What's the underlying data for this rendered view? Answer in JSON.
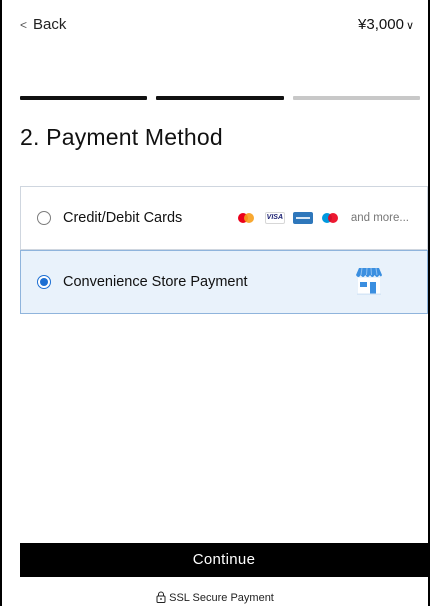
{
  "header": {
    "back_icon": "chevron-left-icon",
    "back_label": "Back",
    "price": "¥3,000",
    "price_icon": "chevron-down-icon"
  },
  "progress": {
    "steps_total": 3,
    "current_step": 2,
    "active_color": "#111111",
    "inactive_color": "#c8c8c8"
  },
  "page": {
    "title": "2. Payment Method"
  },
  "payment_methods": [
    {
      "label": "Credit/Debit Cards",
      "selected": false,
      "icons": [
        "mastercard-icon",
        "visa-icon",
        "amex-icon",
        "maestro-icon"
      ],
      "visa_text": "VISA",
      "more_text": "and more..."
    },
    {
      "label": "Convenience Store Payment",
      "selected": true,
      "icon": "storefront-icon"
    }
  ],
  "colors": {
    "selected_bg": "#e9f2fb",
    "radio_accent": "#1d6fd3",
    "store_blue": "#3b8fe0"
  },
  "footer": {
    "continue_label": "Continue",
    "secure_icon": "lock-icon",
    "secure_label": "SSL Secure Payment"
  }
}
